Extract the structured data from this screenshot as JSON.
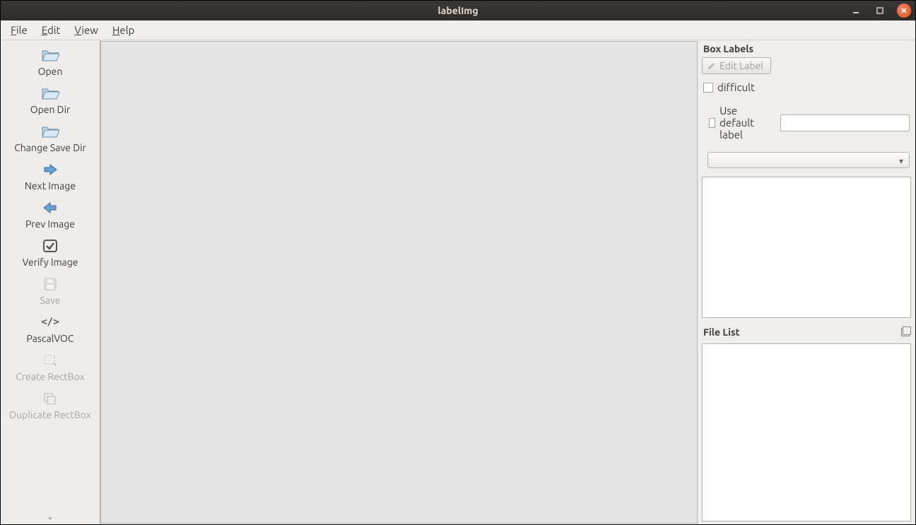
{
  "window": {
    "title": "labelImg"
  },
  "menubar": [
    {
      "label_pre": "",
      "ul": "F",
      "label_post": "ile"
    },
    {
      "label_pre": "",
      "ul": "E",
      "label_post": "dit"
    },
    {
      "label_pre": "",
      "ul": "V",
      "label_post": "iew"
    },
    {
      "label_pre": "",
      "ul": "H",
      "label_post": "elp"
    }
  ],
  "toolbar": [
    {
      "id": "open",
      "label": "Open",
      "icon": "folder-icon",
      "disabled": false
    },
    {
      "id": "open-dir",
      "label": "Open Dir",
      "icon": "folder-icon",
      "disabled": false
    },
    {
      "id": "change-save-dir",
      "label": "Change Save Dir",
      "icon": "folder-icon",
      "disabled": false
    },
    {
      "id": "next-image",
      "label": "Next Image",
      "icon": "arrow-right-icon",
      "disabled": false
    },
    {
      "id": "prev-image",
      "label": "Prev Image",
      "icon": "arrow-left-icon",
      "disabled": false
    },
    {
      "id": "verify-image",
      "label": "Verify Image",
      "icon": "check-icon",
      "disabled": false
    },
    {
      "id": "save",
      "label": "Save",
      "icon": "floppy-icon",
      "disabled": true
    },
    {
      "id": "format",
      "label": "PascalVOC",
      "icon": "code-icon",
      "disabled": false
    },
    {
      "id": "create-rect",
      "label": "Create RectBox",
      "icon": "rect-icon",
      "disabled": true
    },
    {
      "id": "duplicate-rect",
      "label": "Duplicate RectBox",
      "icon": "copy-icon",
      "disabled": true
    }
  ],
  "right": {
    "box_labels_title": "Box Labels",
    "edit_label": "Edit Label",
    "difficult": "difficult",
    "use_default_label": "Use default label",
    "default_label_value": "",
    "combo_value": "",
    "file_list_title": "File List"
  }
}
